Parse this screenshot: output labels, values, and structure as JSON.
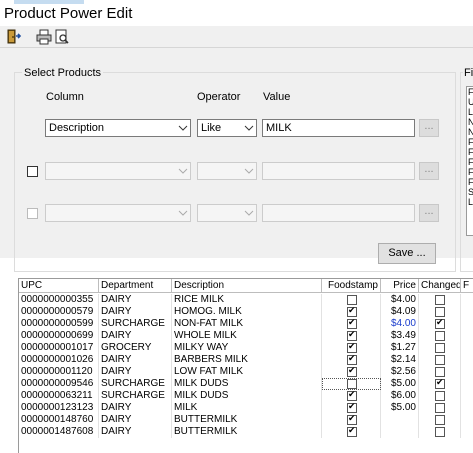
{
  "window": {
    "title": "Product Power Edit"
  },
  "toolbar": {
    "icons": [
      "exit-icon",
      "print-icon",
      "print-preview-icon"
    ]
  },
  "select_products": {
    "label": "Select Products",
    "headers": {
      "column": "Column",
      "operator": "Operator",
      "value": "Value"
    },
    "row1": {
      "column": "Description",
      "operator": "Like",
      "value": "MILK",
      "ellipsis": "..."
    },
    "row2": {
      "column": "",
      "operator": "",
      "value": "",
      "ellipsis": "..."
    },
    "row3": {
      "column": "",
      "operator": "",
      "value": "",
      "ellipsis": "..."
    },
    "save_label": "Save ..."
  },
  "right_panel": {
    "label": "Fi",
    "items": [
      "F",
      "U",
      "L",
      "N",
      "N",
      "F",
      "F",
      "F",
      "F",
      "F",
      "S",
      "L"
    ]
  },
  "grid": {
    "columns": [
      "UPC",
      "Department",
      "Description",
      "Foodstamp",
      "Price",
      "Changed",
      "F"
    ],
    "rows": [
      {
        "upc": "0000000000355",
        "dept": "DAIRY",
        "desc": "RICE MILK",
        "foodstamp": false,
        "price": "$4.00",
        "changed": false,
        "price_highlight": false
      },
      {
        "upc": "0000000000579",
        "dept": "DAIRY",
        "desc": "HOMOG. MILK",
        "foodstamp": true,
        "price": "$4.09",
        "changed": false,
        "price_highlight": false
      },
      {
        "upc": "0000000000599",
        "dept": "SURCHARGE",
        "desc": "NON-FAT MILK",
        "foodstamp": true,
        "price": "$4.00",
        "changed": true,
        "price_highlight": true
      },
      {
        "upc": "0000000000699",
        "dept": "DAIRY",
        "desc": "WHOLE MILK",
        "foodstamp": true,
        "price": "$3.49",
        "changed": false,
        "price_highlight": false
      },
      {
        "upc": "0000000001017",
        "dept": "GROCERY",
        "desc": "MILKY WAY",
        "foodstamp": true,
        "price": "$1.27",
        "changed": false,
        "price_highlight": false
      },
      {
        "upc": "0000000001026",
        "dept": "DAIRY",
        "desc": "BARBERS MILK",
        "foodstamp": true,
        "price": "$2.14",
        "changed": false,
        "price_highlight": false
      },
      {
        "upc": "0000000001120",
        "dept": "DAIRY",
        "desc": "LOW FAT MILK",
        "foodstamp": true,
        "price": "$2.56",
        "changed": false,
        "price_highlight": false
      },
      {
        "upc": "0000000009546",
        "dept": "SURCHARGE",
        "desc": "MILK DUDS",
        "foodstamp": false,
        "price": "$5.00",
        "changed": true,
        "price_highlight": false
      },
      {
        "upc": "0000000063211",
        "dept": "SURCHARGE",
        "desc": "MILK DUDS",
        "foodstamp": true,
        "price": "$6.00",
        "changed": false,
        "price_highlight": false
      },
      {
        "upc": "0000000123123",
        "dept": "DAIRY",
        "desc": "MILK",
        "foodstamp": true,
        "price": "$5.00",
        "changed": false,
        "price_highlight": false
      },
      {
        "upc": "0000000148760",
        "dept": "DAIRY",
        "desc": "BUTTERMILK",
        "foodstamp": true,
        "price": "",
        "changed": false,
        "price_highlight": false
      },
      {
        "upc": "0000001487608",
        "dept": "DAIRY",
        "desc": "BUTTERMILK",
        "foodstamp": true,
        "price": "",
        "changed": false,
        "price_highlight": false
      }
    ]
  },
  "colors": {
    "highlight_price": "#1a3ccc"
  }
}
